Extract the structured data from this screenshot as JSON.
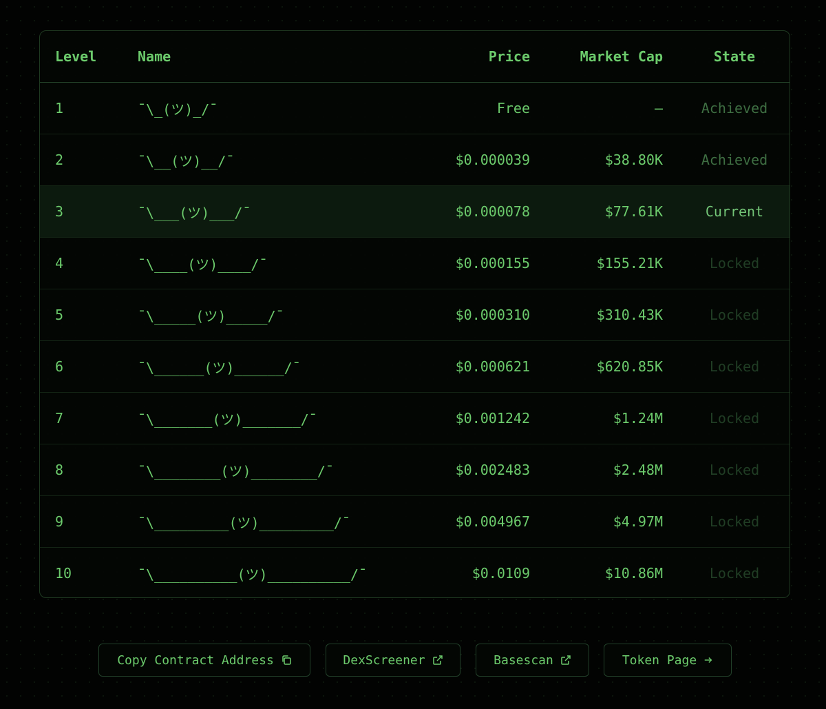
{
  "table": {
    "headers": {
      "level": "Level",
      "name": "Name",
      "price": "Price",
      "market_cap": "Market Cap",
      "state": "State"
    },
    "rows": [
      {
        "level": "1",
        "name": "¯\\_(ツ)_/¯",
        "price": "Free",
        "market_cap": "–",
        "state": "Achieved"
      },
      {
        "level": "2",
        "name": "¯\\__(ツ)__/¯",
        "price": "$0.000039",
        "market_cap": "$38.80K",
        "state": "Achieved"
      },
      {
        "level": "3",
        "name": "¯\\___(ツ)___/¯",
        "price": "$0.000078",
        "market_cap": "$77.61K",
        "state": "Current"
      },
      {
        "level": "4",
        "name": "¯\\____(ツ)____/¯",
        "price": "$0.000155",
        "market_cap": "$155.21K",
        "state": "Locked"
      },
      {
        "level": "5",
        "name": "¯\\_____(ツ)_____/¯",
        "price": "$0.000310",
        "market_cap": "$310.43K",
        "state": "Locked"
      },
      {
        "level": "6",
        "name": "¯\\______(ツ)______/¯",
        "price": "$0.000621",
        "market_cap": "$620.85K",
        "state": "Locked"
      },
      {
        "level": "7",
        "name": "¯\\_______(ツ)_______/¯",
        "price": "$0.001242",
        "market_cap": "$1.24M",
        "state": "Locked"
      },
      {
        "level": "8",
        "name": "¯\\________(ツ)________/¯",
        "price": "$0.002483",
        "market_cap": "$2.48M",
        "state": "Locked"
      },
      {
        "level": "9",
        "name": "¯\\_________(ツ)_________/¯",
        "price": "$0.004967",
        "market_cap": "$4.97M",
        "state": "Locked"
      },
      {
        "level": "10",
        "name": "¯\\__________(ツ)__________/¯",
        "price": "$0.0109",
        "market_cap": "$10.86M",
        "state": "Locked"
      }
    ]
  },
  "actions": {
    "copy_contract": {
      "label": "Copy Contract Address",
      "icon": "copy-icon"
    },
    "dexscreener": {
      "label": "DexScreener",
      "icon": "external-link-icon"
    },
    "basescan": {
      "label": "Basescan",
      "icon": "external-link-icon"
    },
    "token_page": {
      "label": "Token Page",
      "icon": "arrow-right-icon"
    }
  },
  "colors": {
    "accent": "#6ccb6c",
    "achieved": "#3e6e42",
    "current": "#73c577",
    "locked": "#203d24",
    "current_row_bg": "#0c1a0e",
    "border": "#1f3a21",
    "background": "#020302"
  }
}
